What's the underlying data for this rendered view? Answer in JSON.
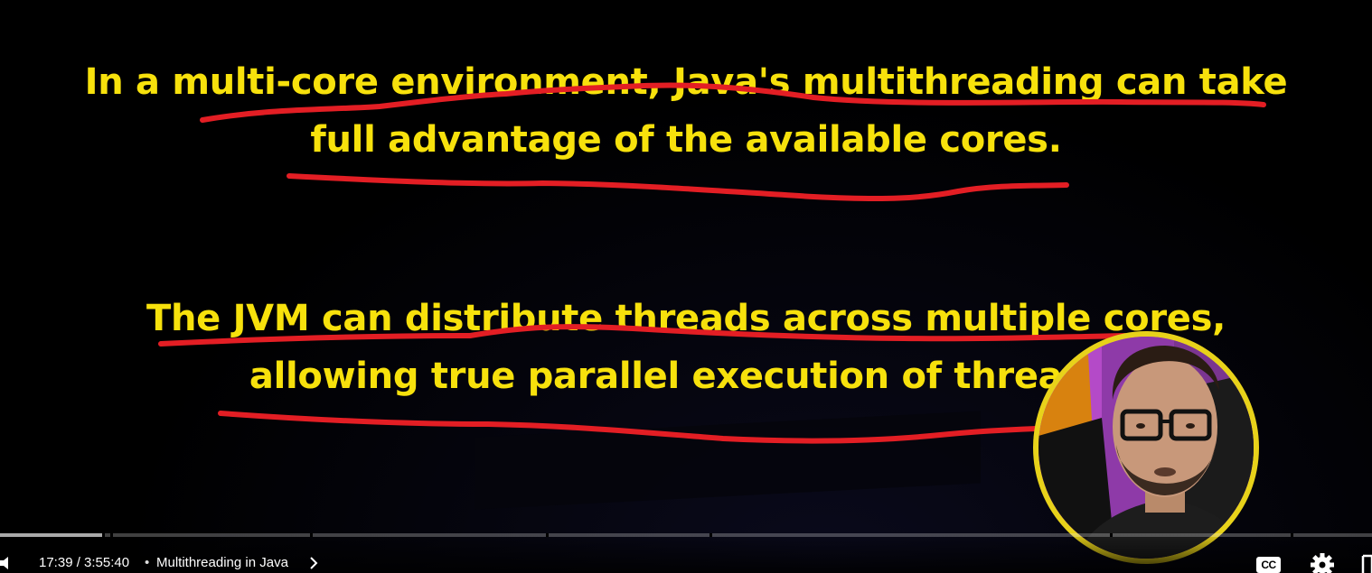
{
  "slide": {
    "paragraph1": {
      "line1": "In a multi-core environment, Java's multithreading can take",
      "line2": "full advantage of the available cores."
    },
    "paragraph2": {
      "line1": "The JVM can distribute threads across multiple cores,",
      "line2": "allowing true parallel execution of threads."
    },
    "text_color": "#f7e10c",
    "annotation_color": "#e31e24"
  },
  "player": {
    "current_time": "17:39",
    "duration": "3:55:40",
    "time_display": "17:39 / 3:55:40",
    "chapter_separator": "•",
    "chapter_title": "Multithreading in Java",
    "progress_fraction": 0.075,
    "cc_label": "CC",
    "webcam_border_color": "#e8d21a",
    "icons": [
      "volume-icon",
      "chevron-right-icon",
      "closed-captions-icon",
      "settings-gear-icon",
      "miniplayer-icon"
    ]
  }
}
